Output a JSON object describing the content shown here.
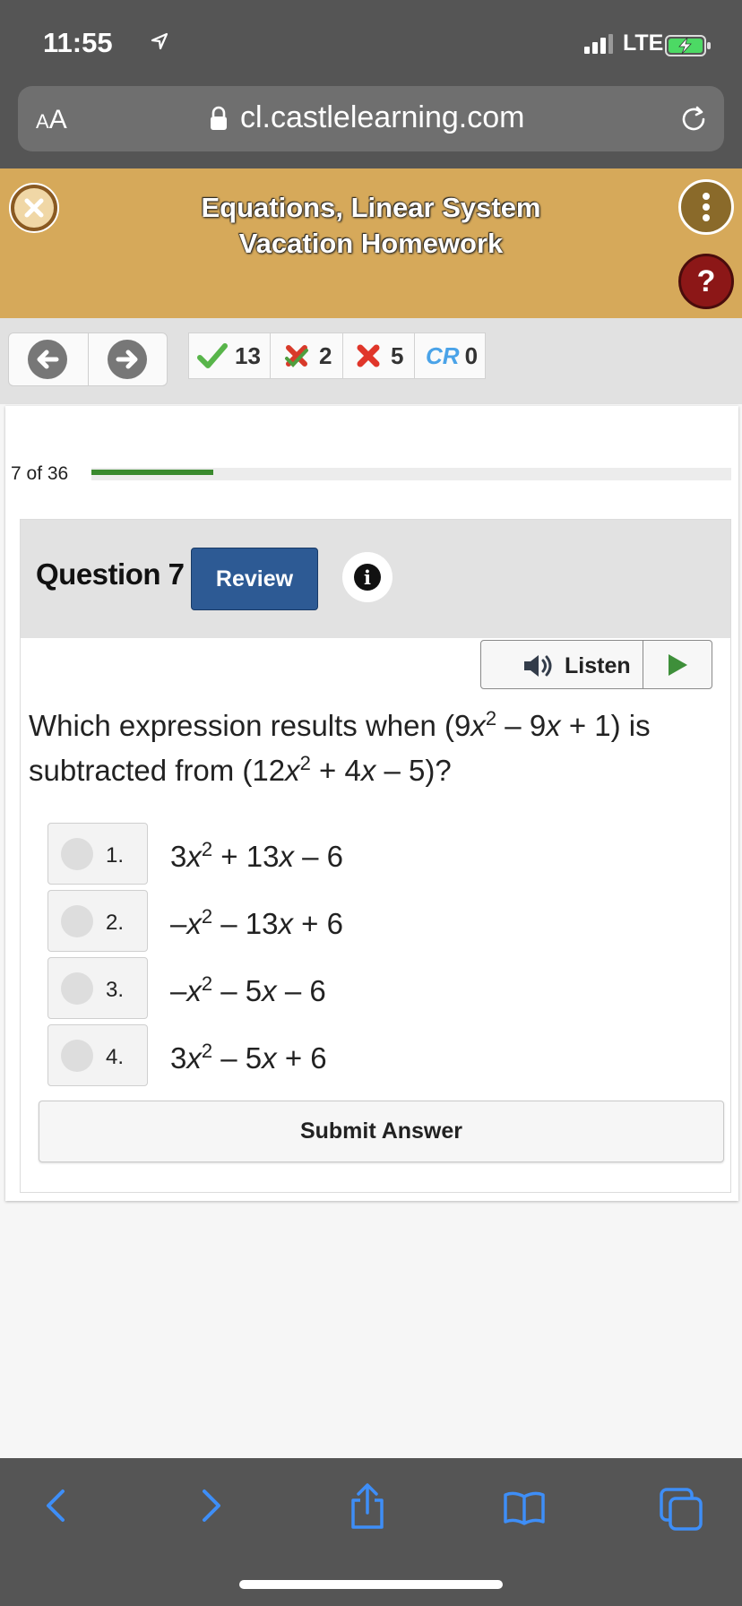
{
  "status_bar": {
    "time": "11:55",
    "network": "LTE"
  },
  "browser": {
    "text_size_label_small": "A",
    "text_size_label_large": "A",
    "url": "cl.castlelearning.com"
  },
  "header": {
    "title": "Equations, Linear System Vacation Homework",
    "help_label": "?"
  },
  "scores": {
    "correct": "13",
    "partial": "2",
    "incorrect": "5",
    "cr_label": "CR",
    "cr_count": "0"
  },
  "progress": {
    "label": "7 of 36",
    "fraction": 0.19
  },
  "question": {
    "label": "Question 7",
    "review_label": "Review",
    "info_label": "i",
    "listen_label": "Listen",
    "text_prefix": "Which expression results when (9",
    "text_x1": "x",
    "text_sup1": "2",
    "text_mid1": " – 9",
    "text_x2": "x",
    "text_mid2": " + 1) is subtracted from (12",
    "text_x3": "x",
    "text_sup2": "2",
    "text_mid3": " + 4",
    "text_x4": "x",
    "text_suffix": " – 5)?"
  },
  "choices": [
    {
      "number": "1.",
      "pre": "3",
      "var": "x",
      "exp": "2",
      "mid": " + 13",
      "var2": "x",
      "post": " – 6"
    },
    {
      "number": "2.",
      "pre": "–",
      "var": "x",
      "exp": "2",
      "mid": " – 13",
      "var2": "x",
      "post": " + 6"
    },
    {
      "number": "3.",
      "pre": "–",
      "var": "x",
      "exp": "2",
      "mid": " – 5",
      "var2": "x",
      "post": " – 6"
    },
    {
      "number": "4.",
      "pre": "3",
      "var": "x",
      "exp": "2",
      "mid": " – 5",
      "var2": "x",
      "post": " + 6"
    }
  ],
  "submit_label": "Submit Answer",
  "colors": {
    "header": "#d6a95a",
    "review": "#2d5a94",
    "progress": "#3a8a2e",
    "safari_icons": "#3e8ef7"
  }
}
